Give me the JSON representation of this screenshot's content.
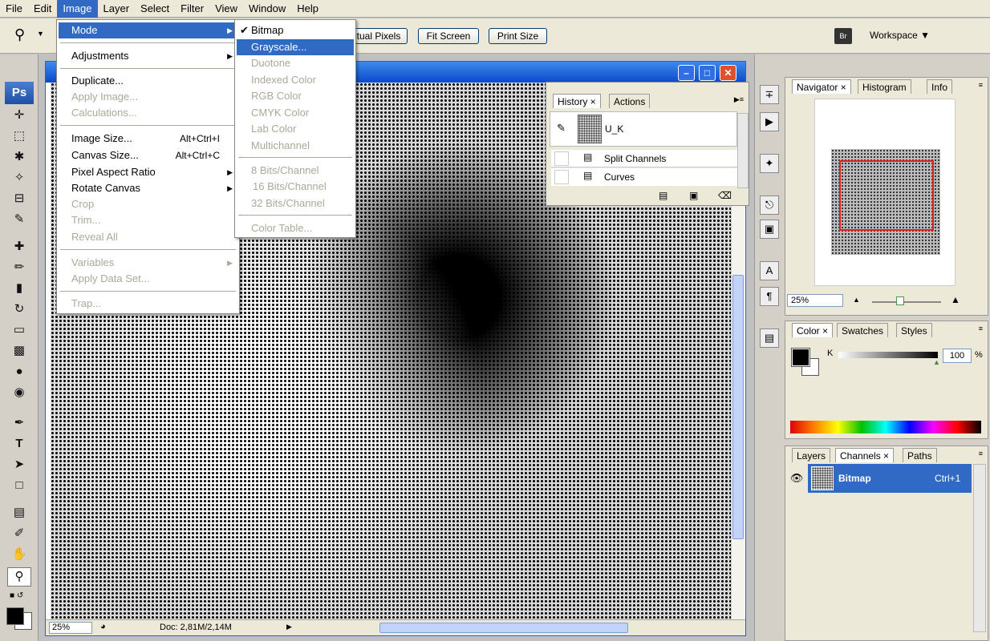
{
  "menubar": [
    "File",
    "Edit",
    "Image",
    "Layer",
    "Select",
    "Filter",
    "View",
    "Window",
    "Help"
  ],
  "active_menu": "Image",
  "options": {
    "actual_pixels": "Actual Pixels",
    "fit_screen": "Fit Screen",
    "print_size": "Print Size",
    "workspace": "Workspace"
  },
  "image_menu": {
    "mode": "Mode",
    "adjustments": "Adjustments",
    "duplicate": "Duplicate...",
    "apply_image": "Apply Image...",
    "calculations": "Calculations...",
    "image_size": "Image Size...",
    "image_size_sc": "Alt+Ctrl+I",
    "canvas_size": "Canvas Size...",
    "canvas_size_sc": "Alt+Ctrl+C",
    "pixel_aspect": "Pixel Aspect Ratio",
    "rotate_canvas": "Rotate Canvas",
    "crop": "Crop",
    "trim": "Trim...",
    "reveal_all": "Reveal All",
    "variables": "Variables",
    "apply_data_set": "Apply Data Set...",
    "trap": "Trap..."
  },
  "mode_menu": {
    "bitmap": "Bitmap",
    "grayscale": "Grayscale...",
    "duotone": "Duotone",
    "indexed": "Indexed Color",
    "rgb": "RGB Color",
    "cmyk": "CMYK Color",
    "lab": "Lab Color",
    "multichannel": "Multichannel",
    "bits8": "8 Bits/Channel",
    "bits16": "16 Bits/Channel",
    "bits32": "32 Bits/Channel",
    "color_table": "Color Table..."
  },
  "document": {
    "zoom": "25%",
    "doc_info": "Doc: 2,81M/2,14M"
  },
  "history": {
    "tab_history": "History",
    "tab_actions": "Actions",
    "snapshot": "U_K",
    "steps": [
      "Split Channels",
      "Curves"
    ]
  },
  "navigator": {
    "tab_navigator": "Navigator",
    "tab_histogram": "Histogram",
    "tab_info": "Info",
    "zoom": "25%"
  },
  "color_panel": {
    "tab_color": "Color",
    "tab_swatches": "Swatches",
    "tab_styles": "Styles",
    "k_label": "K",
    "k_value": "100",
    "unit": "%"
  },
  "layers_panel": {
    "tab_layers": "Layers",
    "tab_channels": "Channels",
    "tab_paths": "Paths",
    "channel_name": "Bitmap",
    "channel_shortcut": "Ctrl+1"
  },
  "tool_logo": "Ps",
  "colors": {
    "menu_highlight": "#316ac5",
    "nav_rect": "#e02020"
  }
}
